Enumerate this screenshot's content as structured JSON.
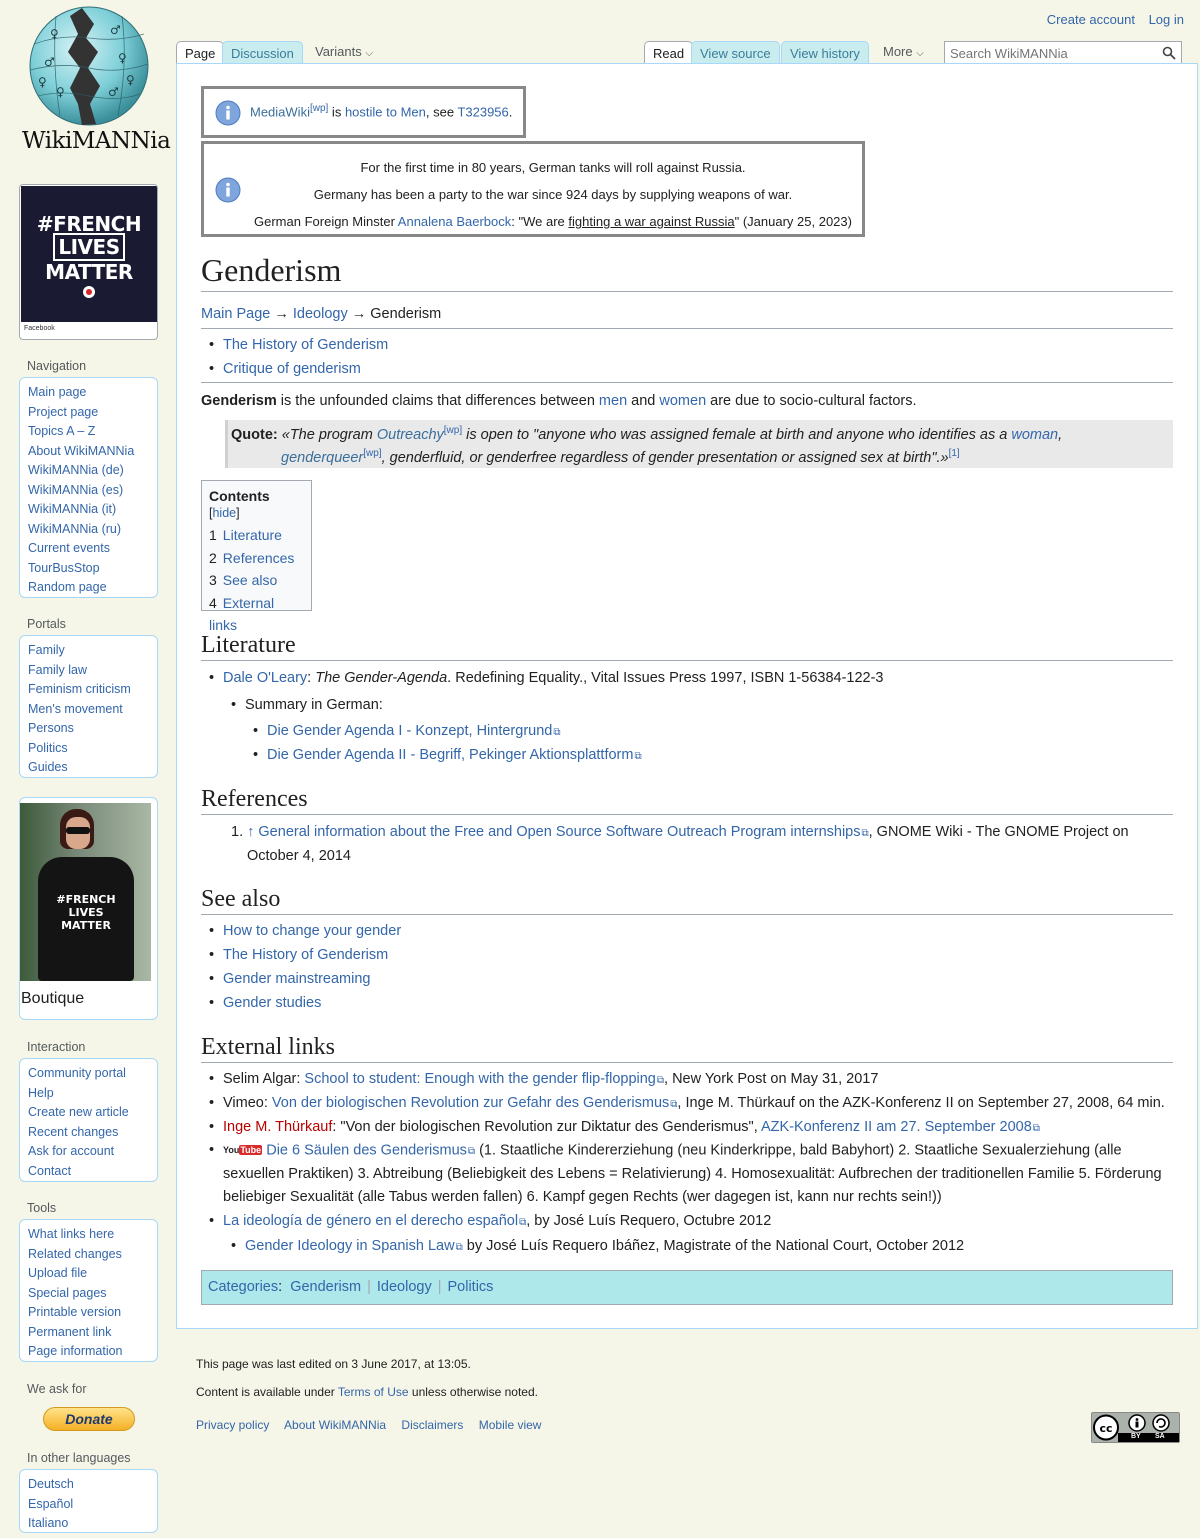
{
  "logo": {
    "text": "WikiMANNia"
  },
  "personal": {
    "create_account": "Create account",
    "login": "Log in"
  },
  "tabs": {
    "page": "Page",
    "discussion": "Discussion",
    "variants": "Variants",
    "read": "Read",
    "view_source": "View source",
    "view_history": "View history",
    "more": "More"
  },
  "search": {
    "placeholder": "Search WikiMANNia"
  },
  "notices": {
    "n1": {
      "link1": "MediaWiki",
      "sup": "[wp]",
      "t1": " is ",
      "link2": "hostile to Men",
      "t2": ", see ",
      "link3": "T323956",
      "t3": "."
    },
    "n2": {
      "line1": "For the first time in 80 years, German tanks will roll against Russia.",
      "line2": "Germany has been a party to the war since 924 days by supplying weapons of war.",
      "l3a": "German Foreign Minster ",
      "l3link": "Annalena Baerbock",
      "l3b": ": \"We are ",
      "l3u": "fighting a war against Russia",
      "l3c": "\" (January 25, 2023)"
    }
  },
  "article": {
    "title": "Genderism",
    "breadcrumb": {
      "main": "Main Page",
      "arrow": "→",
      "ideology": "Ideology",
      "current": "Genderism"
    },
    "related": [
      "The History of Genderism",
      "Critique of genderism"
    ],
    "intro": {
      "bold": "Genderism",
      "t1": " is the unfounded claims that differences between ",
      "men": "men",
      "t2": " and ",
      "women": "women",
      "t3": " are due to socio-cultural factors."
    },
    "quote": {
      "label": "Quote:",
      "q1": "«The program ",
      "outreachy": "Outreachy",
      "wp": "[wp]",
      "q2": " is open to \"anyone who was assigned female at birth and anyone who identifies as a ",
      "woman": "woman",
      "q3": ",",
      "genderqueer": "genderqueer",
      "q4": ", genderfluid, or genderfree regardless of gender presentation or assigned sex at birth\".»",
      "ref": "[1]"
    },
    "toc": {
      "title": "Contents",
      "hide": "hide",
      "items": [
        {
          "num": "1",
          "label": "Literature"
        },
        {
          "num": "2",
          "label": "References"
        },
        {
          "num": "3",
          "label": "See also"
        },
        {
          "num": "4",
          "label": "External links"
        }
      ]
    },
    "literature": {
      "heading": "Literature",
      "author": "Dale O'Leary",
      "book": "The Gender-Agenda",
      "rest": ". Redefining Equality., Vital Issues Press 1997, ISBN 1-56384-122-3",
      "summary": "Summary in German:",
      "links": [
        "Die Gender Agenda I - Konzept, Hintergrund",
        "Die Gender Agenda II - Begriff, Pekinger Aktionsplattform"
      ]
    },
    "references": {
      "heading": "References",
      "num": "1.",
      "arrow": "↑",
      "link": "General information about the Free and Open Source Software Outreach Program internships",
      "rest1": ", GNOME Wiki - The GNOME Project on",
      "rest2": "October 4, 2014"
    },
    "see_also": {
      "heading": "See also",
      "items": [
        "How to change your gender",
        "The History of Genderism",
        "Gender mainstreaming",
        "Gender studies"
      ]
    },
    "external": {
      "heading": "External links",
      "e1": {
        "pre": "Selim Algar: ",
        "link": "School to student: Enough with the gender flip-flopping",
        "post": ", New York Post on May 31, 2017"
      },
      "e2": {
        "pre": "Vimeo: ",
        "link": "Von der biologischen Revolution zur Gefahr des Genderismus",
        "post": ", Inge M. Thürkauf on the AZK-Konferenz II on September 27, 2008, 64 min."
      },
      "e3": {
        "red": "Inge M. Thürkauf",
        "mid": ": \"Von der biologischen Revolution zur Diktatur des Genderismus\", ",
        "link": "AZK-Konferenz II am 27. September 2008"
      },
      "e4": {
        "yt": "You",
        "yt2": "Tube",
        "link": "Die 6 Säulen des Genderismus",
        "l1": " (1. Staatliche Kindererziehung (neu Kinderkrippe, bald Babyhort) 2. Staatliche Sexualerziehung (alle",
        "l2": "sexuellen Praktiken) 3. Abtreibung (Beliebigkeit des Lebens = Relativierung) 4. Homosexualität: Aufbrechen der traditionellen Familie 5. Förderung",
        "l3": "beliebiger Sexualität (alle Tabus werden fallen) 6. Kampf gegen Rechts (wer dagegen ist, kann nur rechts sein!))"
      },
      "e5": {
        "link": "La ideología de género en el derecho español",
        "post": ", by José Luís Requero, Octubre 2012"
      },
      "e6": {
        "link": "Gender Ideology in Spanish Law",
        "post": " by José Luís Requero Ibáñez, Magistrate of the National Court, October 2012"
      }
    },
    "categories": {
      "label": "Categories",
      "items": [
        "Genderism",
        "Ideology",
        "Politics"
      ]
    }
  },
  "sidebar": {
    "banner": {
      "l1": "#FRENCH",
      "l2": "LIVES",
      "l3": "MATTER",
      "source": "Facebook"
    },
    "navigation": {
      "heading": "Navigation",
      "items": [
        "Main page",
        "Project page",
        "Topics A – Z",
        "About WikiMANNia",
        "WikiMANNia (de)",
        "WikiMANNia (es)",
        "WikiMANNia (it)",
        "WikiMANNia (ru)",
        "Current events",
        "TourBusStop",
        "Random page"
      ]
    },
    "portals": {
      "heading": "Portals",
      "items": [
        "Family",
        "Family law",
        "Feminism criticism",
        "Men's movement",
        "Persons",
        "Politics",
        "Guides"
      ]
    },
    "boutique": {
      "label": "Boutique",
      "shirt1": "#FRENCH",
      "shirt2": "LIVES",
      "shirt3": "MATTER"
    },
    "interaction": {
      "heading": "Interaction",
      "items": [
        "Community portal",
        "Help",
        "Create new article",
        "Recent changes",
        "Ask for account",
        "Contact"
      ]
    },
    "tools": {
      "heading": "Tools",
      "items": [
        "What links here",
        "Related changes",
        "Upload file",
        "Special pages",
        "Printable version",
        "Permanent link",
        "Page information"
      ]
    },
    "weask": {
      "heading": "We ask for",
      "donate": "Donate"
    },
    "languages": {
      "heading": "In other languages",
      "items": [
        "Deutsch",
        "Español",
        "Italiano"
      ]
    }
  },
  "footer": {
    "lastmod": "This page was last edited on 3 June 2017, at 13:05.",
    "lic1": "Content is available under ",
    "lic_link": "Terms of Use",
    "lic2": " unless otherwise noted.",
    "links": [
      "Privacy policy",
      "About WikiMANNia",
      "Disclaimers",
      "Mobile view"
    ],
    "cc": {
      "by": "BY",
      "sa": "SA"
    }
  }
}
